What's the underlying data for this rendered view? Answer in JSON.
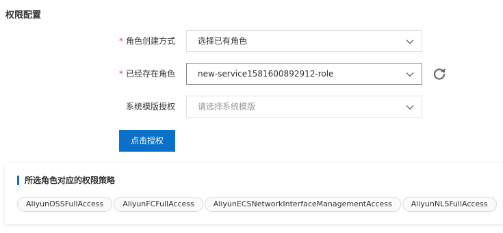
{
  "section": {
    "title": "权限配置"
  },
  "form": {
    "role_creation": {
      "label": "角色创建方式",
      "required_mark": "*",
      "value": "选择已有角色"
    },
    "existing_role": {
      "label": "已经存在角色",
      "required_mark": "*",
      "value": "new-service1581600892912-role"
    },
    "template_auth": {
      "label": "系统模版授权",
      "placeholder": "请选择系统模版"
    },
    "authorize_button": "点击授权"
  },
  "policies": {
    "title": "所选角色对应的权限策略",
    "tags": [
      "AliyunOSSFullAccess",
      "AliyunFCFullAccess",
      "AliyunECSNetworkInterfaceManagementAccess",
      "AliyunNLSFullAccess"
    ]
  },
  "colors": {
    "primary": "#0a70c9",
    "required": "#e84738"
  },
  "icons": {
    "dropdown": "chevron-down-icon",
    "refresh": "refresh-icon"
  }
}
